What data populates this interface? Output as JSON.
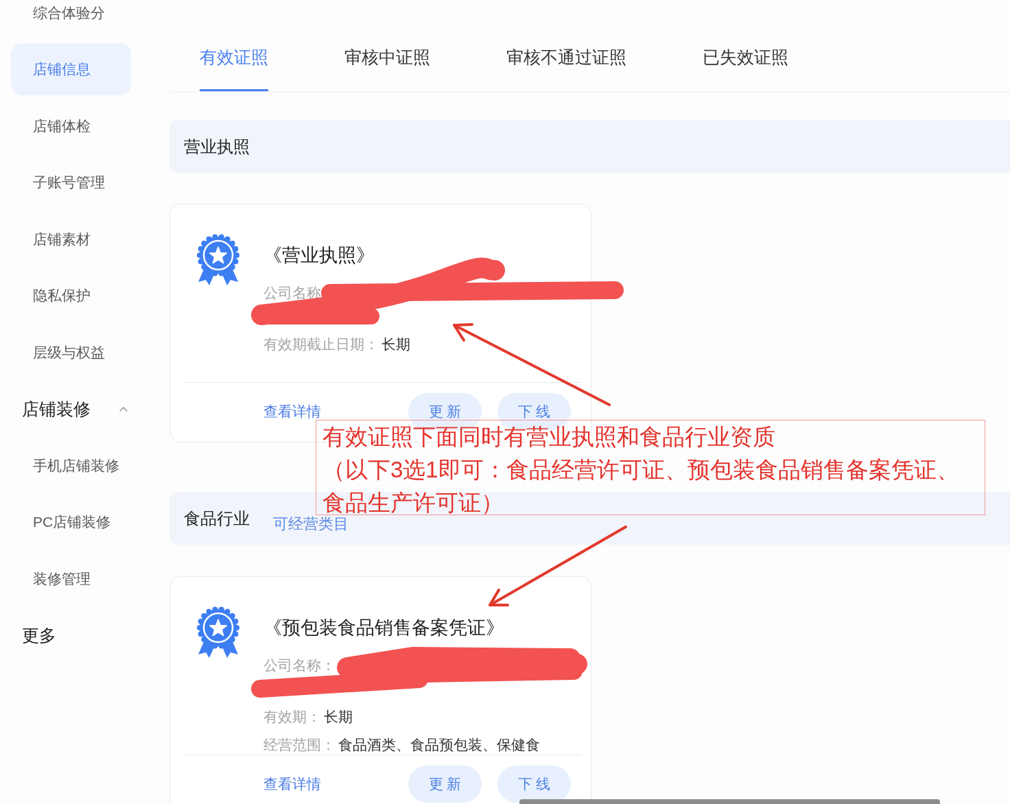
{
  "sidebar": {
    "items": [
      {
        "label": "综合体验分",
        "selected": false
      },
      {
        "label": "店铺信息",
        "selected": true
      },
      {
        "label": "店铺体检",
        "selected": false
      },
      {
        "label": "子账号管理",
        "selected": false
      },
      {
        "label": "店铺素材",
        "selected": false
      },
      {
        "label": "隐私保护",
        "selected": false
      },
      {
        "label": "层级与权益",
        "selected": false
      }
    ],
    "group": {
      "label": "店铺装修",
      "expanded": true,
      "children": [
        {
          "label": "手机店铺装修",
          "selected": false
        },
        {
          "label": "PC店铺装修",
          "selected": false
        },
        {
          "label": "装修管理",
          "selected": false
        }
      ]
    },
    "more_label": "更多"
  },
  "tabs": [
    {
      "label": "有效证照",
      "selected": true
    },
    {
      "label": "审核中证照",
      "selected": false
    },
    {
      "label": "审核不通过证照",
      "selected": false
    },
    {
      "label": "已失效证照",
      "selected": false
    }
  ],
  "sections": [
    {
      "title": "营业执照",
      "cards": [
        {
          "title": "《营业执照》",
          "fields": [
            {
              "label": "公司名称",
              "redacted": true
            },
            {
              "label": "有效期截止日期：",
              "value": "长期",
              "redacted": false
            }
          ],
          "details_link": "查看详情",
          "buttons": [
            "更 新",
            "下 线"
          ]
        }
      ]
    },
    {
      "title": "食品行业",
      "link": "可经营类目",
      "cards": [
        {
          "title": "《预包装食品销售备案凭证》",
          "fields": [
            {
              "label": "公司名称：",
              "redacted": true
            },
            {
              "label": "有效期：",
              "value": "长期",
              "redacted": false
            },
            {
              "label": "经营范围：",
              "value": "食品酒类、食品预包装、保健食",
              "redacted": false
            }
          ],
          "details_link": "查看详情",
          "buttons": [
            "更 新",
            "下 线"
          ]
        }
      ]
    }
  ],
  "annotation": {
    "lines": [
      "有效证照下面同时有营业执照和食品行业资质",
      "（以下3选1即可：食品经营许可证、预包装食品销售备案凭证、",
      "食品生产许可证）"
    ]
  }
}
